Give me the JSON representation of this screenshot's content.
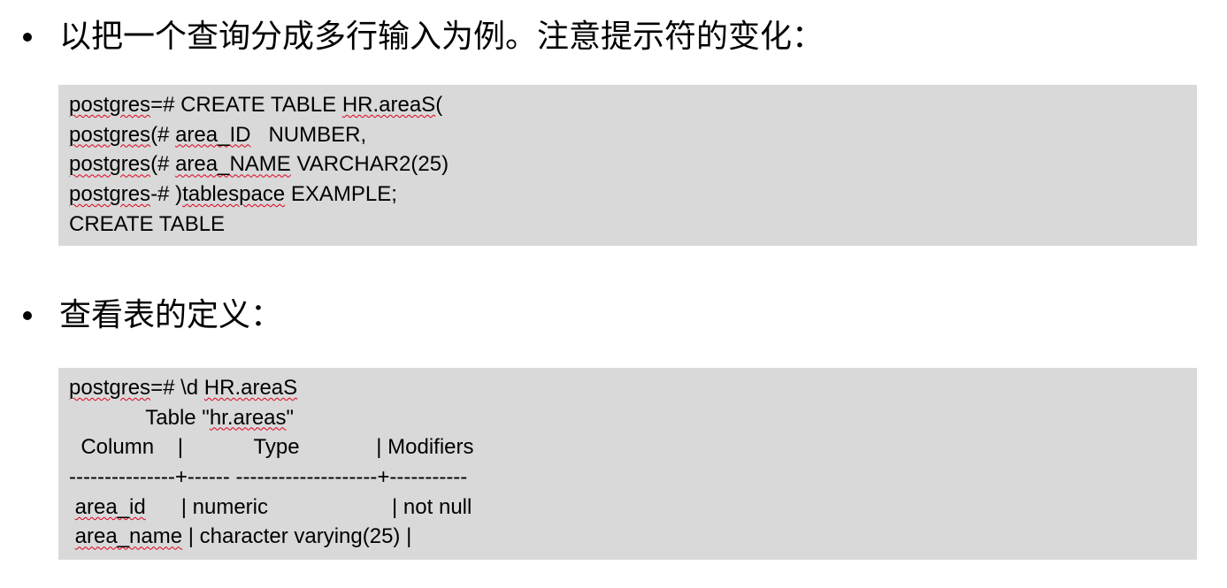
{
  "section1": {
    "heading": "以把一个查询分成多行输入为例。注意提示符的变化：",
    "lines": [
      [
        {
          "t": "postgres",
          "sq": true
        },
        {
          "t": "=# CREATE TABLE ",
          "sq": false
        },
        {
          "t": "HR.areaS",
          "sq": true
        },
        {
          "t": "(",
          "sq": false
        }
      ],
      [
        {
          "t": "postgres",
          "sq": true
        },
        {
          "t": "(# ",
          "sq": false
        },
        {
          "t": "area_ID",
          "sq": true
        },
        {
          "t": "   NUMBER,",
          "sq": false
        }
      ],
      [
        {
          "t": "postgres",
          "sq": true
        },
        {
          "t": "(# ",
          "sq": false
        },
        {
          "t": "area_NAME",
          "sq": true
        },
        {
          "t": " VARCHAR2(25)",
          "sq": false
        }
      ],
      [
        {
          "t": "postgres",
          "sq": true
        },
        {
          "t": "-# )",
          "sq": false
        },
        {
          "t": "tablespace",
          "sq": true
        },
        {
          "t": " EXAMPLE;",
          "sq": false
        }
      ],
      [
        {
          "t": "CREATE TABLE",
          "sq": false
        }
      ]
    ]
  },
  "section2": {
    "heading": "查看表的定义：",
    "lines": [
      [
        {
          "t": "postgres",
          "sq": true
        },
        {
          "t": "=# \\d ",
          "sq": false
        },
        {
          "t": "HR.areaS",
          "sq": true
        }
      ],
      [
        {
          "t": "             Table \"",
          "sq": false
        },
        {
          "t": "hr.areas",
          "sq": true
        },
        {
          "t": "\"",
          "sq": false
        }
      ],
      [
        {
          "t": "  Column    |            Type             | Modifiers",
          "sq": false
        }
      ],
      [
        {
          "t": "---------------+------ --------------------+-----------",
          "sq": false
        }
      ],
      [
        {
          "t": " ",
          "sq": false
        },
        {
          "t": "area_id",
          "sq": true
        },
        {
          "t": "      | numeric                     | not null",
          "sq": false
        }
      ],
      [
        {
          "t": " ",
          "sq": false
        },
        {
          "t": "area_name",
          "sq": true
        },
        {
          "t": " | character varying(25) |",
          "sq": false
        }
      ]
    ]
  },
  "colors": {
    "code_background": "#d9d9d9",
    "spellcheck_underline": "#e0001b"
  }
}
